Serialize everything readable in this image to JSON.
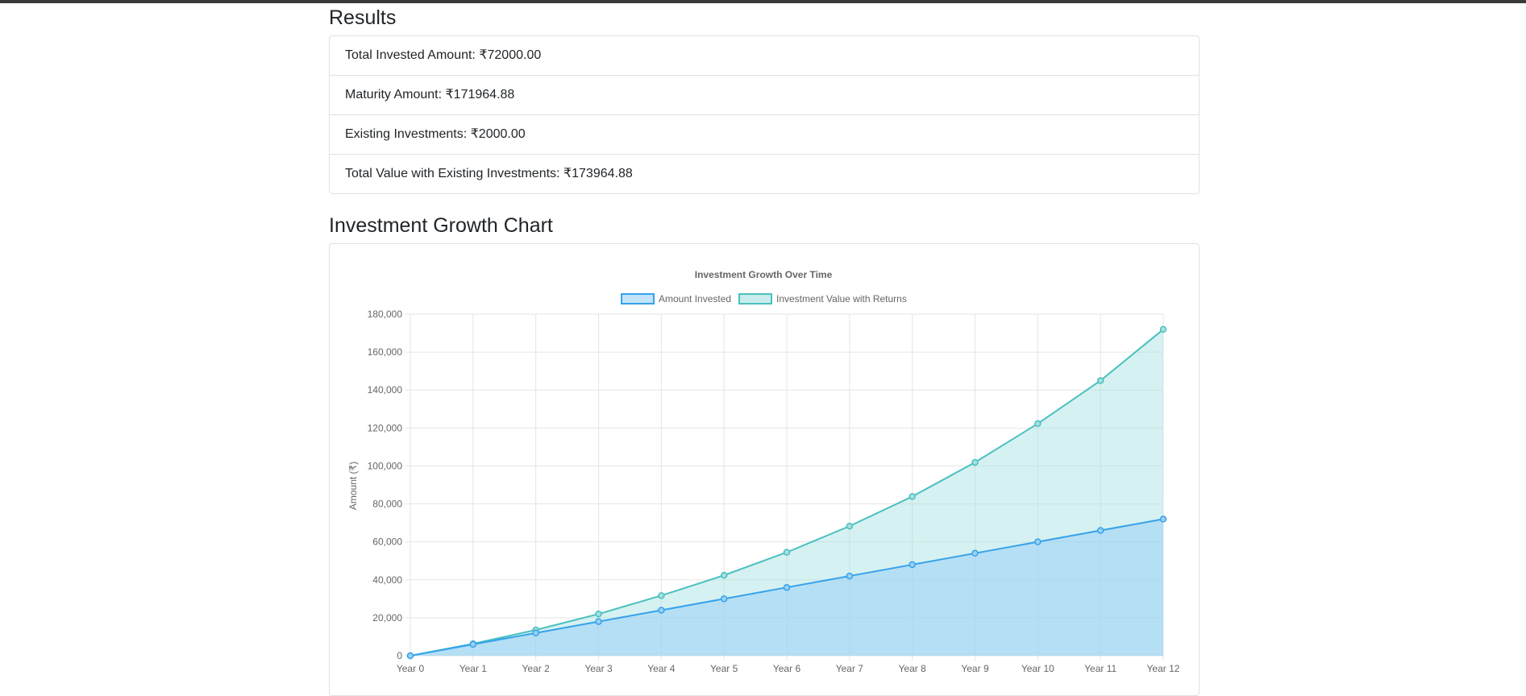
{
  "results": {
    "title": "Results",
    "items": [
      {
        "label": "Total Invested Amount: ₹72000.00"
      },
      {
        "label": "Maturity Amount: ₹171964.88"
      },
      {
        "label": "Existing Investments: ₹2000.00"
      },
      {
        "label": "Total Value with Existing Investments: ₹173964.88"
      }
    ]
  },
  "chart_section": {
    "title": "Investment Growth Chart"
  },
  "chart_data": {
    "type": "area",
    "title": "Investment Growth Over Time",
    "xlabel": "",
    "ylabel": "Amount (₹)",
    "categories": [
      "Year 0",
      "Year 1",
      "Year 2",
      "Year 3",
      "Year 4",
      "Year 5",
      "Year 6",
      "Year 7",
      "Year 8",
      "Year 9",
      "Year 10",
      "Year 11",
      "Year 12"
    ],
    "ylim": [
      0,
      180000
    ],
    "yticks": [
      0,
      20000,
      40000,
      60000,
      80000,
      100000,
      120000,
      140000,
      160000,
      180000
    ],
    "ytick_labels": [
      "0",
      "20,000",
      "40,000",
      "60,000",
      "80,000",
      "100,000",
      "120,000",
      "140,000",
      "160,000",
      "180,000"
    ],
    "grid": true,
    "legend_position": "top",
    "series": [
      {
        "name": "Amount Invested",
        "color": "#36a2eb",
        "fill": "#9ad0f5",
        "values": [
          0,
          6000,
          12000,
          18000,
          24000,
          30000,
          36000,
          42000,
          48000,
          54000,
          60000,
          66000,
          72000
        ]
      },
      {
        "name": "Investment Value with Returns",
        "color": "#4bc0c0",
        "fill": "#a5dfdf",
        "values": [
          0,
          6300,
          13600,
          22000,
          31700,
          42400,
          54500,
          68300,
          83900,
          101900,
          122300,
          145000,
          171965
        ]
      }
    ]
  }
}
